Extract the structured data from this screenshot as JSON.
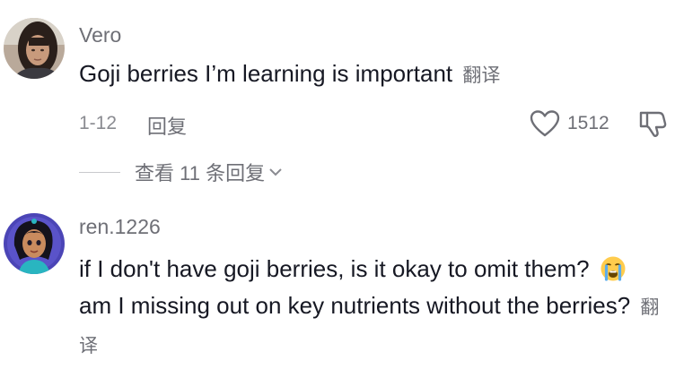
{
  "comments": [
    {
      "username": "Vero",
      "text": "Goji berries I’m learning is important",
      "translate_label": "翻译",
      "date": "1-12",
      "reply_label": "回复",
      "like_count": "1512",
      "view_replies_label": "查看 11 条回复",
      "avatar_icon": "avatar-photo-woman"
    },
    {
      "username": "ren.1226",
      "text_part1": "if I don't have goji berries, is it okay to omit them?",
      "text_part2": "am I missing out on key nutrients without the berries?",
      "emoji": "loudly-crying-face",
      "translate_label": "翻译",
      "avatar_icon": "avatar-cartoon-princess"
    }
  ],
  "colors": {
    "primary_text": "#161823",
    "secondary_text": "#6e6f76",
    "divider": "#c9cacd"
  }
}
